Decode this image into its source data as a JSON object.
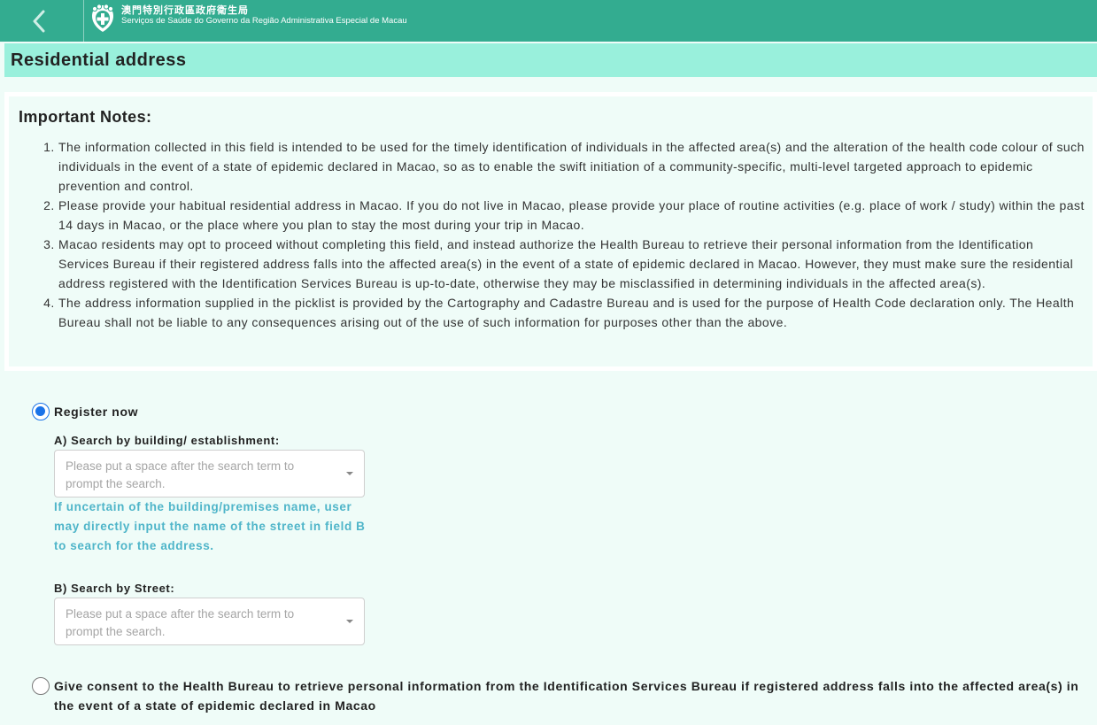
{
  "header": {
    "org_name_zh": "澳門特別行政區政府衛生局",
    "org_name_pt": "Serviços de Saúde do Governo da Região Administrativa Especial de Macau"
  },
  "page": {
    "title": "Residential address"
  },
  "notes": {
    "heading": "Important Notes:",
    "items": [
      "The information collected in this field is intended to be used for the timely identification of individuals in the affected area(s) and the alteration of the health code colour of such individuals in the event of a state of epidemic declared in Macao, so as to enable the swift initiation of a community-specific, multi-level targeted approach to epidemic prevention and control.",
      "Please provide your habitual residential address in Macao. If you do not live in Macao, please provide your place of routine activities (e.g. place of work / study) within the past 14 days in Macao, or the place where you plan to stay the most during your trip in Macao.",
      "Macao residents may opt to proceed without completing this field, and instead authorize the Health Bureau to retrieve their personal information from the Identification Services Bureau if their registered address falls into the affected area(s) in the event of a state of epidemic declared in Macao. However, they must make sure the residential address registered with the Identification Services Bureau is up-to-date, otherwise they may be misclassified in determining individuals in the affected area(s).",
      "The address information supplied in the picklist is provided by the Cartography and Cadastre Bureau and is used for the purpose of Health Code declaration only. The Health Bureau shall not be liable to any consequences arising out of the use of such information for purposes other than the above."
    ]
  },
  "form": {
    "register_now": {
      "label": "Register now",
      "selected": true
    },
    "search_building": {
      "label": "A) Search by building/ establishment:",
      "placeholder": "Please put a space after the search term to prompt the search."
    },
    "hint": "If uncertain of the building/premises name, user may directly input the name of the street in field B to search for the address.",
    "search_street": {
      "label": "B) Search by Street:",
      "placeholder": "Please put a space after the search term to prompt the search."
    },
    "consent": {
      "label": "Give consent to the Health Bureau to retrieve personal information from the Identification Services Bureau if registered address falls into the affected area(s) in the event of a state of epidemic declared in Macao",
      "selected": false
    }
  },
  "colors": {
    "header_bg": "#33ac90",
    "title_bar_bg": "#99f0dc",
    "page_bg": "#effcf8",
    "hint_text": "#4fb5c9",
    "radio_selected": "#1a73e8"
  },
  "icons": {
    "back": "chevron-left-icon",
    "logo": "health-bureau-logo-icon",
    "dropdown": "caret-down-icon"
  }
}
